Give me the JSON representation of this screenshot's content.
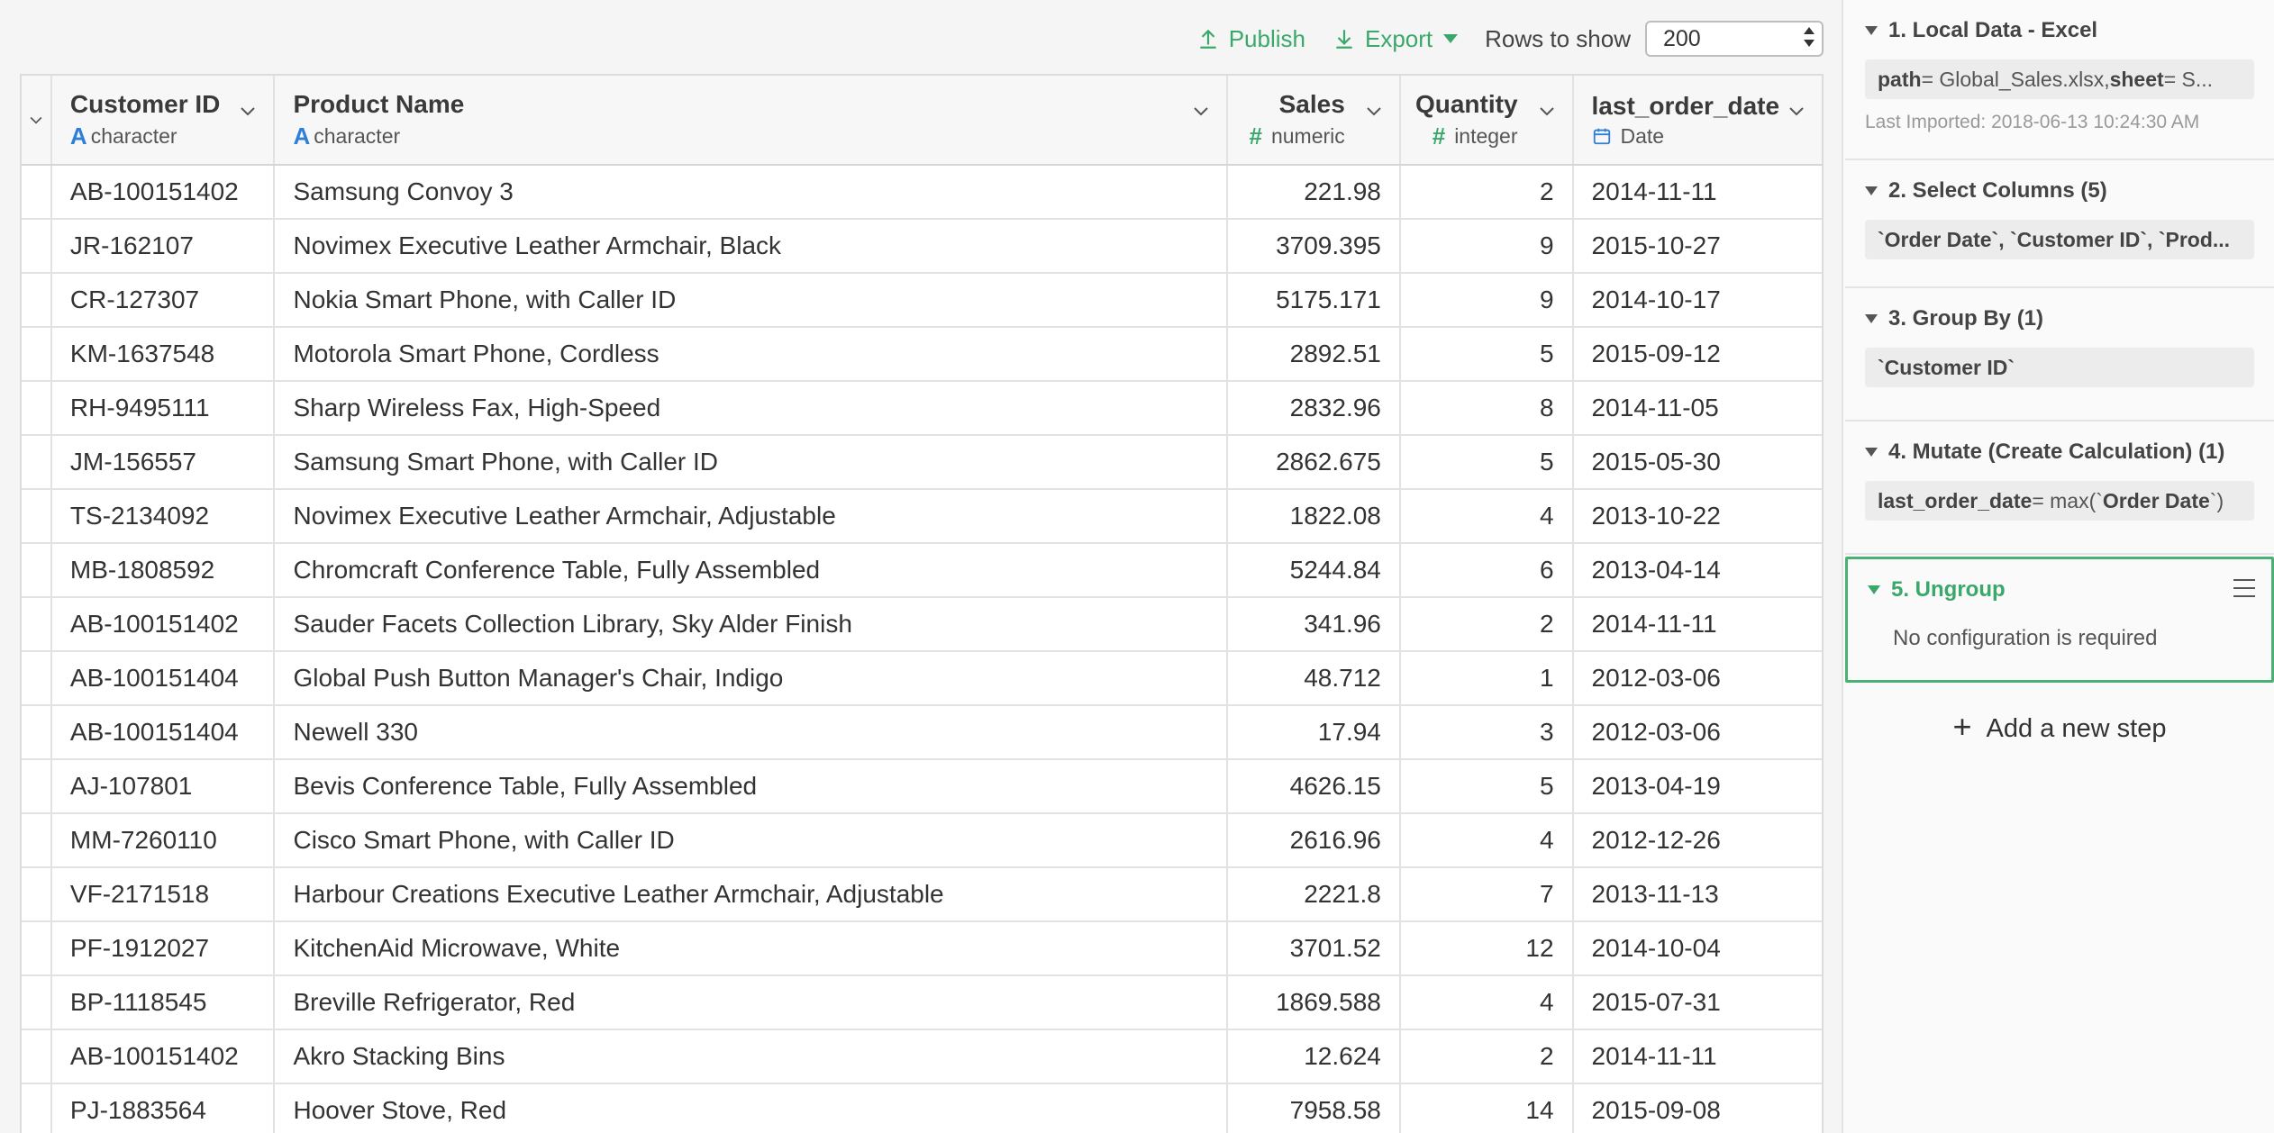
{
  "toolbar": {
    "publish_label": "Publish",
    "export_label": "Export",
    "rows_to_show_label": "Rows to show",
    "rows_to_show_value": "200"
  },
  "table": {
    "columns": [
      {
        "name": "Customer ID",
        "type": "character",
        "type_icon": "A"
      },
      {
        "name": "Product Name",
        "type": "character",
        "type_icon": "A"
      },
      {
        "name": "Sales",
        "type": "numeric",
        "type_icon": "#"
      },
      {
        "name": "Quantity",
        "type": "integer",
        "type_icon": "#"
      },
      {
        "name": "last_order_date",
        "type": "Date",
        "type_icon": "calendar-icon"
      }
    ],
    "rows": [
      [
        "AB-100151402",
        "Samsung Convoy 3",
        "221.98",
        "2",
        "2014-11-11"
      ],
      [
        "JR-162107",
        "Novimex Executive Leather Armchair, Black",
        "3709.395",
        "9",
        "2015-10-27"
      ],
      [
        "CR-127307",
        "Nokia Smart Phone, with Caller ID",
        "5175.171",
        "9",
        "2014-10-17"
      ],
      [
        "KM-1637548",
        "Motorola Smart Phone, Cordless",
        "2892.51",
        "5",
        "2015-09-12"
      ],
      [
        "RH-9495111",
        "Sharp Wireless Fax, High-Speed",
        "2832.96",
        "8",
        "2014-11-05"
      ],
      [
        "JM-156557",
        "Samsung Smart Phone, with Caller ID",
        "2862.675",
        "5",
        "2015-05-30"
      ],
      [
        "TS-2134092",
        "Novimex Executive Leather Armchair, Adjustable",
        "1822.08",
        "4",
        "2013-10-22"
      ],
      [
        "MB-1808592",
        "Chromcraft Conference Table, Fully Assembled",
        "5244.84",
        "6",
        "2013-04-14"
      ],
      [
        "AB-100151402",
        "Sauder Facets Collection Library, Sky Alder Finish",
        "341.96",
        "2",
        "2014-11-11"
      ],
      [
        "AB-100151404",
        "Global Push Button Manager's Chair, Indigo",
        "48.712",
        "1",
        "2012-03-06"
      ],
      [
        "AB-100151404",
        "Newell 330",
        "17.94",
        "3",
        "2012-03-06"
      ],
      [
        "AJ-107801",
        "Bevis Conference Table, Fully Assembled",
        "4626.15",
        "5",
        "2013-04-19"
      ],
      [
        "MM-7260110",
        "Cisco Smart Phone, with Caller ID",
        "2616.96",
        "4",
        "2012-12-26"
      ],
      [
        "VF-2171518",
        "Harbour Creations Executive Leather Armchair, Adjustable",
        "2221.8",
        "7",
        "2013-11-13"
      ],
      [
        "PF-1912027",
        "KitchenAid Microwave, White",
        "3701.52",
        "12",
        "2014-10-04"
      ],
      [
        "BP-1118545",
        "Breville Refrigerator, Red",
        "1869.588",
        "4",
        "2015-07-31"
      ],
      [
        "AB-100151402",
        "Akro Stacking Bins",
        "12.624",
        "2",
        "2014-11-11"
      ],
      [
        "PJ-1883564",
        "Hoover Stove, Red",
        "7958.58",
        "14",
        "2015-09-08"
      ]
    ]
  },
  "steps": {
    "step1": {
      "title": "1. Local Data - Excel",
      "chip_key1": "path",
      "chip_val1": " = Global_Sales.xlsx, ",
      "chip_key2": "sheet",
      "chip_val2": " = S...",
      "last_imported": "Last Imported: 2018-06-13 10:24:30 AM"
    },
    "step2": {
      "title": "2. Select Columns (5)",
      "chip": "`Order Date`, `Customer ID`, `Prod..."
    },
    "step3": {
      "title": "3. Group By (1)",
      "chip": "`Customer ID`"
    },
    "step4": {
      "title": "4. Mutate (Create Calculation) (1)",
      "chip_key": "last_order_date",
      "chip_mid": " = max(`",
      "chip_arg": "Order Date",
      "chip_end": "`)"
    },
    "step5": {
      "title": "5. Ungroup",
      "note": "No configuration is required"
    }
  },
  "add_step_label": "Add a new step",
  "colors": {
    "accent_green": "#3aa86a",
    "type_blue": "#2f7fd8"
  }
}
